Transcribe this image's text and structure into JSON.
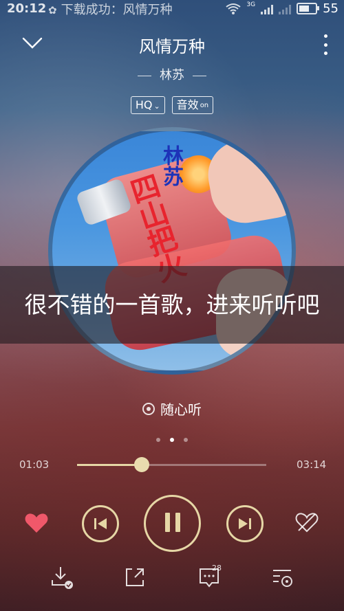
{
  "status_bar": {
    "time": "20:12",
    "notification": "下载成功：风情万种",
    "network": "3G",
    "battery": "55"
  },
  "player": {
    "title": "风情万种",
    "artist": "林苏",
    "quality_badge": "HQ",
    "effect_badge": "音效",
    "effect_state": "on",
    "album_text_artist": "林苏",
    "album_text_title": "四山把火",
    "caption": "很不错的一首歌，进来听听吧",
    "radio_label": "随心听",
    "page_index": 2,
    "page_count": 3,
    "current_time": "01:03",
    "total_time": "03:14",
    "progress": 0.34,
    "comment_count": "28"
  },
  "colors": {
    "accent": "#e6d7a6",
    "heart": "#f0586a"
  },
  "icons": [
    "chevron-down-icon",
    "more-vertical-icon",
    "heart-icon",
    "previous-icon",
    "pause-icon",
    "next-icon",
    "heart-broken-icon",
    "download-icon",
    "share-icon",
    "comment-icon",
    "playlist-icon",
    "radio-icon"
  ]
}
